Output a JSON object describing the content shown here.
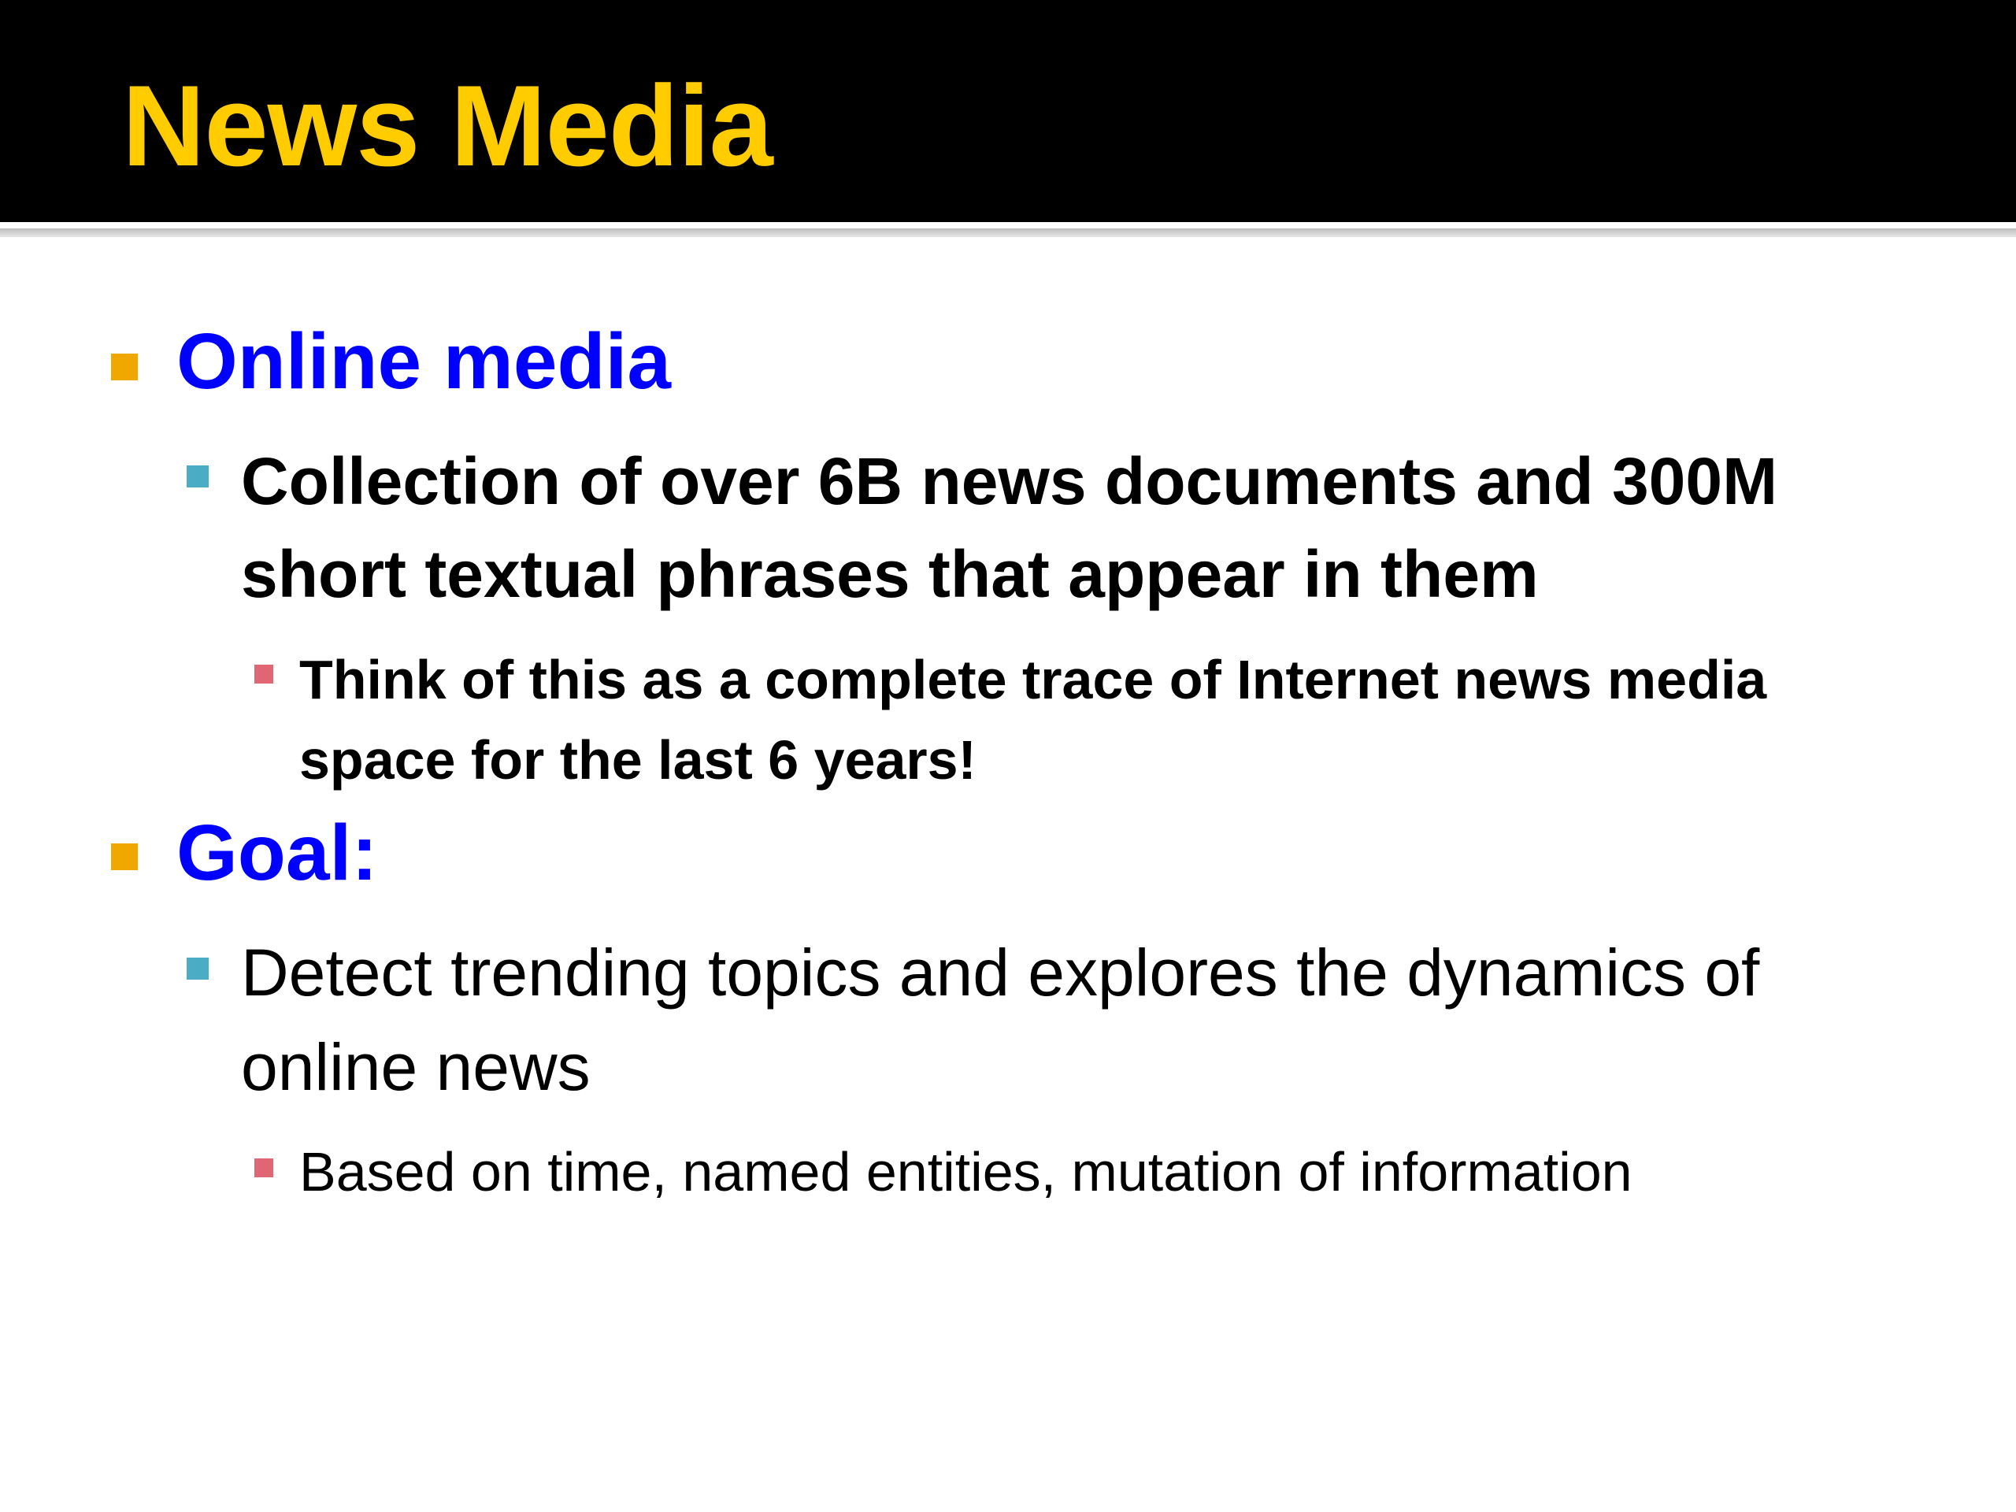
{
  "slide": {
    "title": "News Media",
    "title_color": "#FFCC00",
    "header_background": "#000000",
    "colors": {
      "level1_text": "#0000FF",
      "level1_bullet": "#F0A800",
      "level2_bullet": "#4BACC6",
      "level3_bullet": "#E06673"
    },
    "bullets": [
      {
        "text": "Online media",
        "children": [
          {
            "lines": [
              "Collection of over 6B news documents and 300M",
              "short textual phrases that appear in them"
            ],
            "children": [
              {
                "lines": [
                  "Think of this as a complete trace of Internet news media",
                  "space for the last 6 years!"
                ]
              }
            ]
          }
        ]
      },
      {
        "text": "Goal:",
        "children": [
          {
            "lines": [
              "Detect trending topics and explores the dynamics of",
              "online news"
            ],
            "children": [
              {
                "lines": [
                  "Based on time, named entities, mutation of information"
                ]
              }
            ]
          }
        ]
      }
    ]
  }
}
